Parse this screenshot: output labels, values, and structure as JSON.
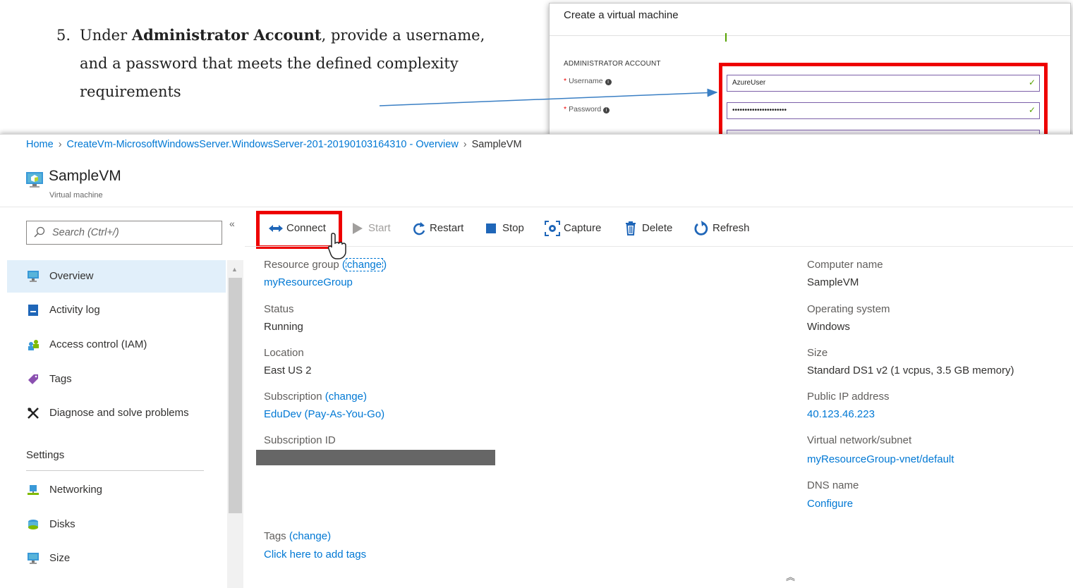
{
  "instruction": {
    "number": "5.",
    "prefix": "Under ",
    "bold": "Administrator Account",
    "suffix": ", provide a username, and a password that meets the defined complexity requirements"
  },
  "create_vm": {
    "title": "Create a virtual machine",
    "section": "ADMINISTRATOR ACCOUNT",
    "username_label": "Username",
    "username_value": "AzureUser",
    "password_label": "Password",
    "password_value": "••••••••••••••••••••••"
  },
  "breadcrumb": {
    "home": "Home",
    "deployment": "CreateVm-MicrosoftWindowsServer.WindowsServer-201-20190103164310 - Overview",
    "current": "SampleVM"
  },
  "resource": {
    "name": "SampleVM",
    "type": "Virtual machine"
  },
  "search": {
    "placeholder": "Search (Ctrl+/)",
    "collapse_glyph": "«"
  },
  "nav": {
    "overview": "Overview",
    "activity_log": "Activity log",
    "access_control": "Access control (IAM)",
    "tags": "Tags",
    "diagnose": "Diagnose and solve problems",
    "settings_header": "Settings",
    "networking": "Networking",
    "disks": "Disks",
    "size": "Size"
  },
  "toolbar": {
    "connect": "Connect",
    "start": "Start",
    "restart": "Restart",
    "stop": "Stop",
    "capture": "Capture",
    "delete": "Delete",
    "refresh": "Refresh"
  },
  "essentials": {
    "resource_group_label": "Resource group",
    "change": "change",
    "resource_group_value": "myResourceGroup",
    "status_label": "Status",
    "status_value": "Running",
    "location_label": "Location",
    "location_value": "East US 2",
    "subscription_label": "Subscription",
    "subscription_value": "EduDev (Pay-As-You-Go)",
    "subscription_id_label": "Subscription ID",
    "tags_label": "Tags",
    "tags_value": "Click here to add tags",
    "computer_name_label": "Computer name",
    "computer_name_value": "SampleVM",
    "os_label": "Operating system",
    "os_value": "Windows",
    "size_label": "Size",
    "size_value": "Standard DS1 v2 (1 vcpus, 3.5 GB memory)",
    "public_ip_label": "Public IP address",
    "public_ip_value": "40.123.46.223",
    "vnet_label": "Virtual network/subnet",
    "vnet_value": "myResourceGroup-vnet/default",
    "dns_label": "DNS name",
    "dns_value": "Configure",
    "collapse_glyph": "⌃⌃"
  },
  "colors": {
    "accent": "#0078d4",
    "highlight": "#ee0000",
    "valid": "#57a300",
    "selected_nav": "#e1effa"
  }
}
